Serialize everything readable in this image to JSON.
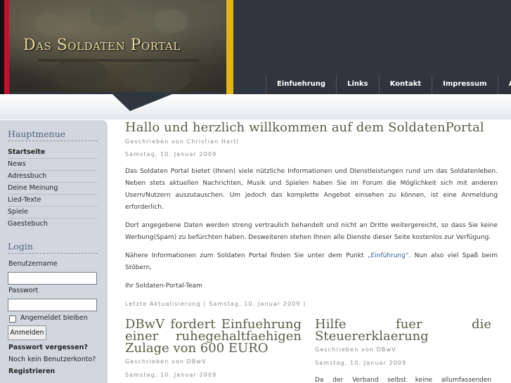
{
  "header": {
    "logo_title": "Das Soldaten Portal",
    "colors": {
      "dark": "#303640",
      "flag_black": "#111111",
      "flag_red": "#c8102e",
      "flag_gold": "#e3b31a"
    }
  },
  "nav": {
    "items": [
      "Einfuehrung",
      "Links",
      "Kontakt",
      "Impressum",
      "AGB"
    ]
  },
  "sidebar": {
    "main_menu_heading": "Hauptmenue",
    "menu": [
      "Startseite",
      "News",
      "Adressbuch",
      "Deine Meinung",
      "Lied-Texte",
      "Spiele",
      "Gaestebuch"
    ],
    "login_heading": "Login",
    "username_label": "Benutzername",
    "username_value": "",
    "password_label": "Passwort",
    "password_value": "",
    "remember_label": "Angemeldet bleiben",
    "login_button": "Anmelden",
    "forgot_password": "Passwort vergessen?",
    "no_account": "Noch kein Benutzerkonto?",
    "register": "Registrieren"
  },
  "article": {
    "title": "Hallo und herzlich willkommen auf dem SoldatenPortal",
    "author": "Geschrieben von Christian Hartl",
    "date": "Samstag, 10. Januar 2009",
    "paragraphs": [
      "Das Soldaten Portal bietet (Ihnen) viele nützliche Informationen und Dienstleistungen rund um das Soldatenleben. Neben stets aktuellen Nachrichten, Musik und Spielen haben Sie im Forum die Möglichkeit sich mit anderen Usern/Nutzern auszutauschen. Um jedoch das komplette Angebot einsehen zu können, ist eine Anmeldung erforderlich.",
      "Dort angegebene Daten werden streng vertraulich behandelt und nicht an Dritte weitergereicht, so dass Sie keine Werbung(Spam) zu befürchten haben. Desweiteren stehen Ihnen alle Dienste dieser Seite kostenlos zur Verfügung."
    ],
    "more_info_prefix": "Nähere Informationen zum Soldaten Portal finden Sie unter dem Punkt",
    "more_info_link": "„Einführung“.",
    "more_info_suffix": "Nun also viel Spaß beim Stöbern,",
    "signoff": "Ihr Soldaten-Portal-Team",
    "last_update": "Letzte Aktualisierung ( Samstag, 10. Januar 2009 )"
  },
  "articles_bottom": [
    {
      "title": "DBwV fordert Einfuehrung einer ruhegehaltfaehigen Zulage von 600 EURO",
      "author": "Geschrieben von DBwV",
      "date": "Samstag, 10. Januar 2009"
    },
    {
      "title": "Hilfe fuer die Steuererklaerung",
      "author": "Geschrieben von DBwV",
      "date": "Samstag, 10. Januar 2009",
      "snippet": "Da der Verband selbst keine allumfassenden"
    }
  ]
}
